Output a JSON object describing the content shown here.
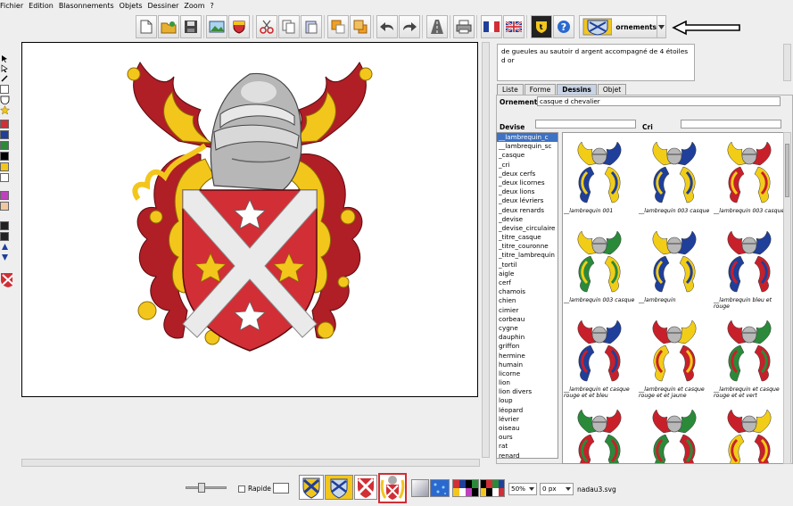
{
  "menu": [
    "Fichier",
    "Edition",
    "Blasonnements",
    "Objets",
    "Dessiner",
    "Zoom",
    "?"
  ],
  "toolbar": {
    "ornament_label": "ornements",
    "lang_fr": "FR",
    "lang_en": "EN"
  },
  "description": "de gueules au sautoir d argent accompagné de 4 étoiles d or",
  "tabs": [
    "Liste",
    "Forme",
    "Dessins",
    "Objet"
  ],
  "panel": {
    "ornements_label": "Ornements",
    "ornements_value": "casque d chevalier",
    "devise_label": "Devise",
    "devise_value": "",
    "cri_label": "Cri",
    "cri_value": ""
  },
  "list_items": [
    "__lambrequin_c",
    "__lambrequin_sc",
    "_casque",
    "_cri",
    "_deux cerfs",
    "_deux licornes",
    "_deux lions",
    "_deux lévriers",
    "_deux renards",
    "_devise",
    "_devise_circulaire",
    "_titre_casque",
    "_titre_couronne",
    "_titre_lambrequin",
    "_tortil",
    "aigle",
    "cerf",
    "chamois",
    "chien",
    "cimier",
    "corbeau",
    "cygne",
    "dauphin",
    "griffon",
    "hermine",
    "humain",
    "licorne",
    "lion",
    "lion divers",
    "loup",
    "léopard",
    "lévrier",
    "oiseau",
    "ours",
    "rat",
    "renard"
  ],
  "gallery": [
    {
      "label": "__lambrequin 001",
      "colors": [
        "#f2cd18",
        "#1f3f9a"
      ]
    },
    {
      "label": "__lambrequin 003 casque",
      "colors": [
        "#f2cd18",
        "#1f3f9a"
      ]
    },
    {
      "label": "__lambrequin 003 casque",
      "colors": [
        "#f2cd18",
        "#c8202a"
      ]
    },
    {
      "label": "__lambrequin 003 casque",
      "colors": [
        "#f2cd18",
        "#2a8a3a"
      ]
    },
    {
      "label": "__lambrequin",
      "colors": [
        "#f2cd18",
        "#1f3f9a"
      ]
    },
    {
      "label": "__lambrequin bleu et rouge",
      "colors": [
        "#c8202a",
        "#1f3f9a"
      ]
    },
    {
      "label": "__lambrequin et casque rouge et et bleu",
      "colors": [
        "#c8202a",
        "#1f3f9a"
      ]
    },
    {
      "label": "__lambrequin et casque rouge et et jaune",
      "colors": [
        "#c8202a",
        "#f2cd18"
      ]
    },
    {
      "label": "__lambrequin et casque rouge et et vert",
      "colors": [
        "#c8202a",
        "#2a8a3a"
      ]
    },
    {
      "label": "",
      "colors": [
        "#2a8a3a",
        "#c8202a"
      ]
    },
    {
      "label": "",
      "colors": [
        "#c8202a",
        "#2a8a3a"
      ]
    },
    {
      "label": "",
      "colors": [
        "#c8202a",
        "#f2cd18"
      ]
    }
  ],
  "status": {
    "rapide_label": "Rapide",
    "zoom": "50%",
    "offset": "0 px",
    "filename": "nadau3.svg"
  },
  "colors": {
    "gules": "#d12e36",
    "gules_dark": "#b01e26",
    "or": "#f3c61c",
    "argent": "#f0f0f0",
    "accent": "#3d72c4"
  },
  "icons": {
    "new": "new-file-icon",
    "open": "open-folder-icon",
    "save": "save-disk-icon",
    "help": "help-icon"
  }
}
